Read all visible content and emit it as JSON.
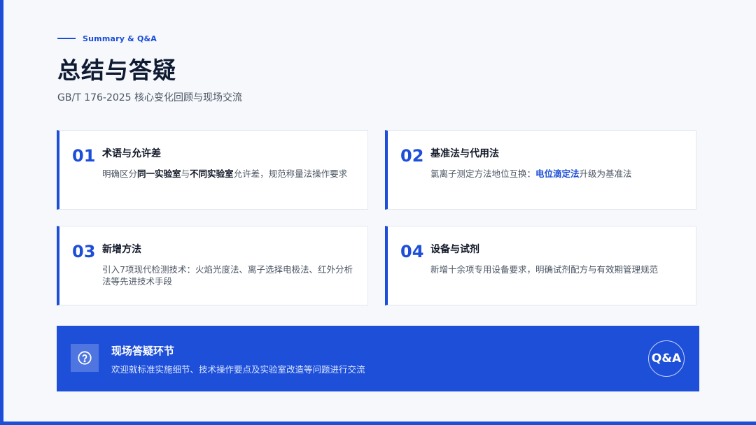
{
  "header": {
    "kicker": "Summary & Q&A",
    "title": "总结与答疑",
    "subtitle": "GB/T 176-2025 核心变化回顾与现场交流"
  },
  "cards": [
    {
      "num": "01",
      "title": "术语与允许差",
      "desc": {
        "p1": "明确区分",
        "b1": "同一实验室",
        "p2": "与",
        "b2": "不同实验室",
        "p3": "允许差，规范称量法操作要求"
      }
    },
    {
      "num": "02",
      "title": "基准法与代用法",
      "desc": {
        "p1": "氯离子测定方法地位互换：",
        "hl": "电位滴定法",
        "p2": "升级为基准法"
      }
    },
    {
      "num": "03",
      "title": "新增方法",
      "desc": "引入7项现代检测技术：火焰光度法、离子选择电极法、红外分析法等先进技术手段"
    },
    {
      "num": "04",
      "title": "设备与试剂",
      "desc": "新增十余项专用设备要求，明确试剂配方与有效期管理规范"
    }
  ],
  "qa_banner": {
    "icon": "question-circle-icon",
    "title": "现场答疑环节",
    "desc": "欢迎就标准实施细节、技术操作要点及实验室改造等问题进行交流",
    "badge": "Q&A"
  },
  "colors": {
    "accent": "#1d4ed8",
    "background": "#f6f8fc",
    "card": "#ffffff",
    "banner": "#1d4fd8"
  }
}
